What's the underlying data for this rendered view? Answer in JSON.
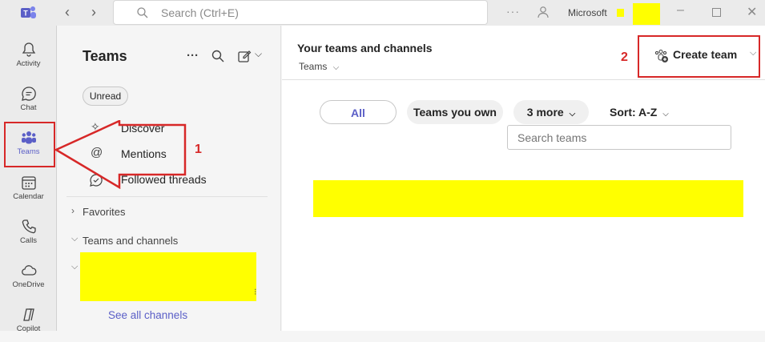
{
  "titlebar": {
    "search_placeholder": "Search (Ctrl+E)",
    "org_name": "Microsoft"
  },
  "rail": {
    "items": [
      {
        "label": "Activity"
      },
      {
        "label": "Chat"
      },
      {
        "label": "Teams"
      },
      {
        "label": "Calendar"
      },
      {
        "label": "Calls"
      },
      {
        "label": "OneDrive"
      },
      {
        "label": "Copilot"
      }
    ]
  },
  "pane": {
    "title": "Teams",
    "filter_chip": "Unread",
    "quick_links": [
      {
        "label": "Discover",
        "icon": "sparkle-icon"
      },
      {
        "label": "Mentions",
        "icon": "at-icon"
      },
      {
        "label": "Followed threads",
        "icon": "followed-icon"
      }
    ],
    "sections": [
      {
        "label": "Favorites"
      },
      {
        "label": "Teams and channels"
      }
    ],
    "see_all_link": "See all channels"
  },
  "main": {
    "title": "Your teams and channels",
    "subtitle": "Teams",
    "create_button": "Create team",
    "filters": {
      "all": "All",
      "owned": "Teams you own",
      "more": "3 more",
      "sort": "Sort: A-Z"
    },
    "search_placeholder": "Search teams"
  },
  "annotations": {
    "marker_1": "1",
    "marker_2": "2",
    "color": "#d72828",
    "redaction_color": "#ffff00"
  },
  "colors": {
    "brand": "#5b5fc7",
    "rail_bg": "#ebebeb",
    "pane_bg": "#f5f5f5"
  }
}
